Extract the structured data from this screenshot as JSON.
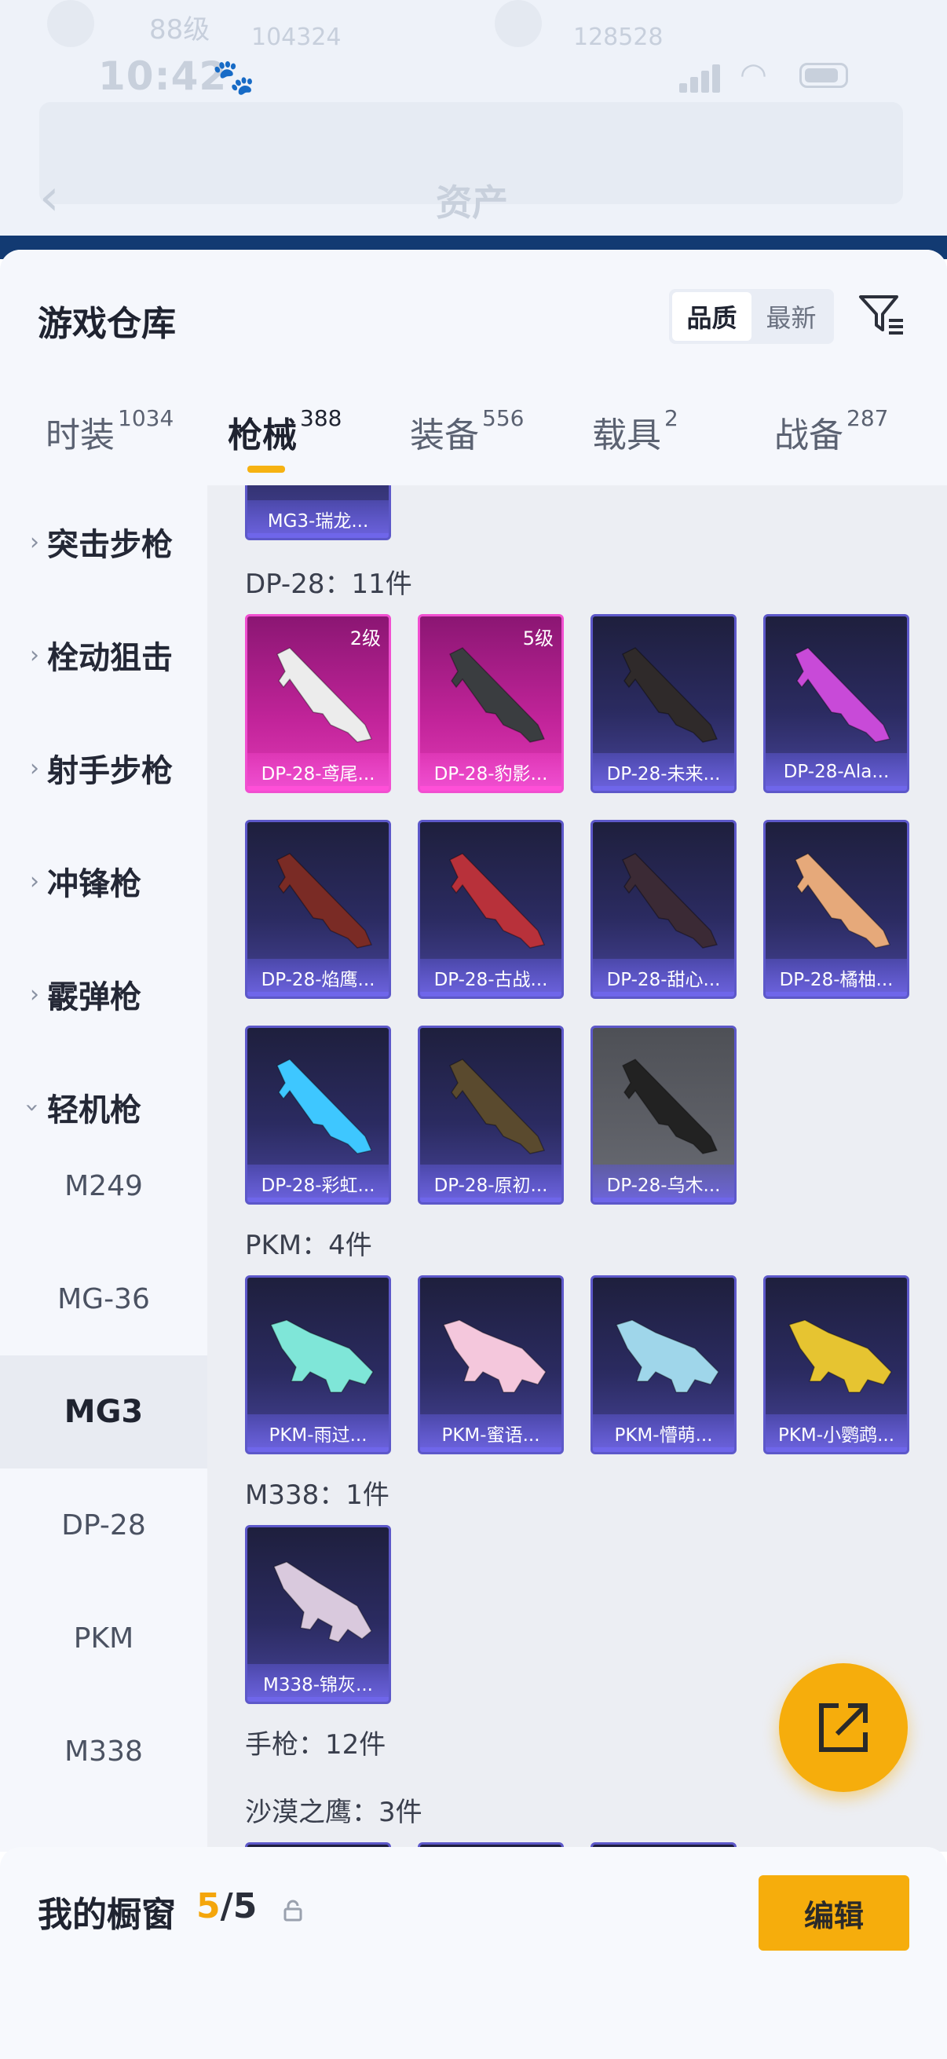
{
  "status_bar": {
    "time": "10:42"
  },
  "background": {
    "title": "资产",
    "ghost_level": "88级",
    "ghost_score1": "104324",
    "ghost_score2": "128528"
  },
  "sheet": {
    "title": "游戏仓库",
    "sort_options": [
      "品质",
      "最新"
    ],
    "sort_selected": "品质"
  },
  "tabs": [
    {
      "label": "时装",
      "count": "1034"
    },
    {
      "label": "枪械",
      "count": "388"
    },
    {
      "label": "装备",
      "count": "556"
    },
    {
      "label": "载具",
      "count": "2"
    },
    {
      "label": "战备",
      "count": "287"
    }
  ],
  "active_tab": "枪械",
  "sidebar": {
    "categories": [
      "突击步枪",
      "栓动狙击",
      "射手步枪",
      "冲锋枪",
      "霰弹枪",
      "轻机枪"
    ],
    "expanded": "轻机枪",
    "subitems": [
      "M249",
      "MG-36",
      "MG3",
      "DP-28",
      "PKM",
      "M338"
    ],
    "selected": "MG3"
  },
  "content": {
    "top_partial_card": "MG3-瑞龙...",
    "sections": [
      {
        "label": "DP-28：11件",
        "items": [
          {
            "name": "DP-28-鸢尾...",
            "level": "2级",
            "rarity": "pink",
            "color": "#ececec"
          },
          {
            "name": "DP-28-豹影...",
            "level": "5级",
            "rarity": "pink",
            "color": "#3a3d40"
          },
          {
            "name": "DP-28-未来...",
            "level": "",
            "rarity": "purple",
            "color": "#2f2a2a"
          },
          {
            "name": "DP-28-Ala...",
            "level": "",
            "rarity": "purple",
            "color": "#c84ad8"
          },
          {
            "name": "DP-28-焰鹰...",
            "level": "",
            "rarity": "purple",
            "color": "#7a2b25"
          },
          {
            "name": "DP-28-古战...",
            "level": "",
            "rarity": "purple",
            "color": "#b8313a"
          },
          {
            "name": "DP-28-甜心...",
            "level": "",
            "rarity": "purple",
            "color": "#3b2a35"
          },
          {
            "name": "DP-28-橘柚...",
            "level": "",
            "rarity": "purple",
            "color": "#e6a97a"
          },
          {
            "name": "DP-28-彩虹...",
            "level": "",
            "rarity": "purple",
            "color": "#3ec7ff"
          },
          {
            "name": "DP-28-原初...",
            "level": "",
            "rarity": "purple",
            "color": "#5a4a2e"
          },
          {
            "name": "DP-28-乌木...",
            "level": "",
            "rarity": "gray",
            "color": "#222222"
          }
        ]
      },
      {
        "label": "PKM：4件",
        "items": [
          {
            "name": "PKM-雨过...",
            "level": "",
            "rarity": "purple",
            "color": "#7fe6d8"
          },
          {
            "name": "PKM-蜜语...",
            "level": "",
            "rarity": "purple",
            "color": "#f4c7dc"
          },
          {
            "name": "PKM-懵萌...",
            "level": "",
            "rarity": "purple",
            "color": "#9fd6ea"
          },
          {
            "name": "PKM-小鹦鹉...",
            "level": "",
            "rarity": "purple",
            "color": "#e6c431"
          }
        ]
      },
      {
        "label": "M338：1件",
        "items": [
          {
            "name": "M338-锦灰...",
            "level": "",
            "rarity": "purple",
            "color": "#d9c9dd"
          }
        ]
      }
    ],
    "pistol_label": "手枪：12件",
    "deagle_label": "沙漠之鹰：3件"
  },
  "showcase": {
    "label": "我的橱窗",
    "current": "5",
    "total": "/5",
    "edit_label": "编辑"
  },
  "colors": {
    "accent": "#f6ad0c",
    "pink_rarity": "#e03ab6",
    "purple_rarity": "#5d58c9"
  }
}
